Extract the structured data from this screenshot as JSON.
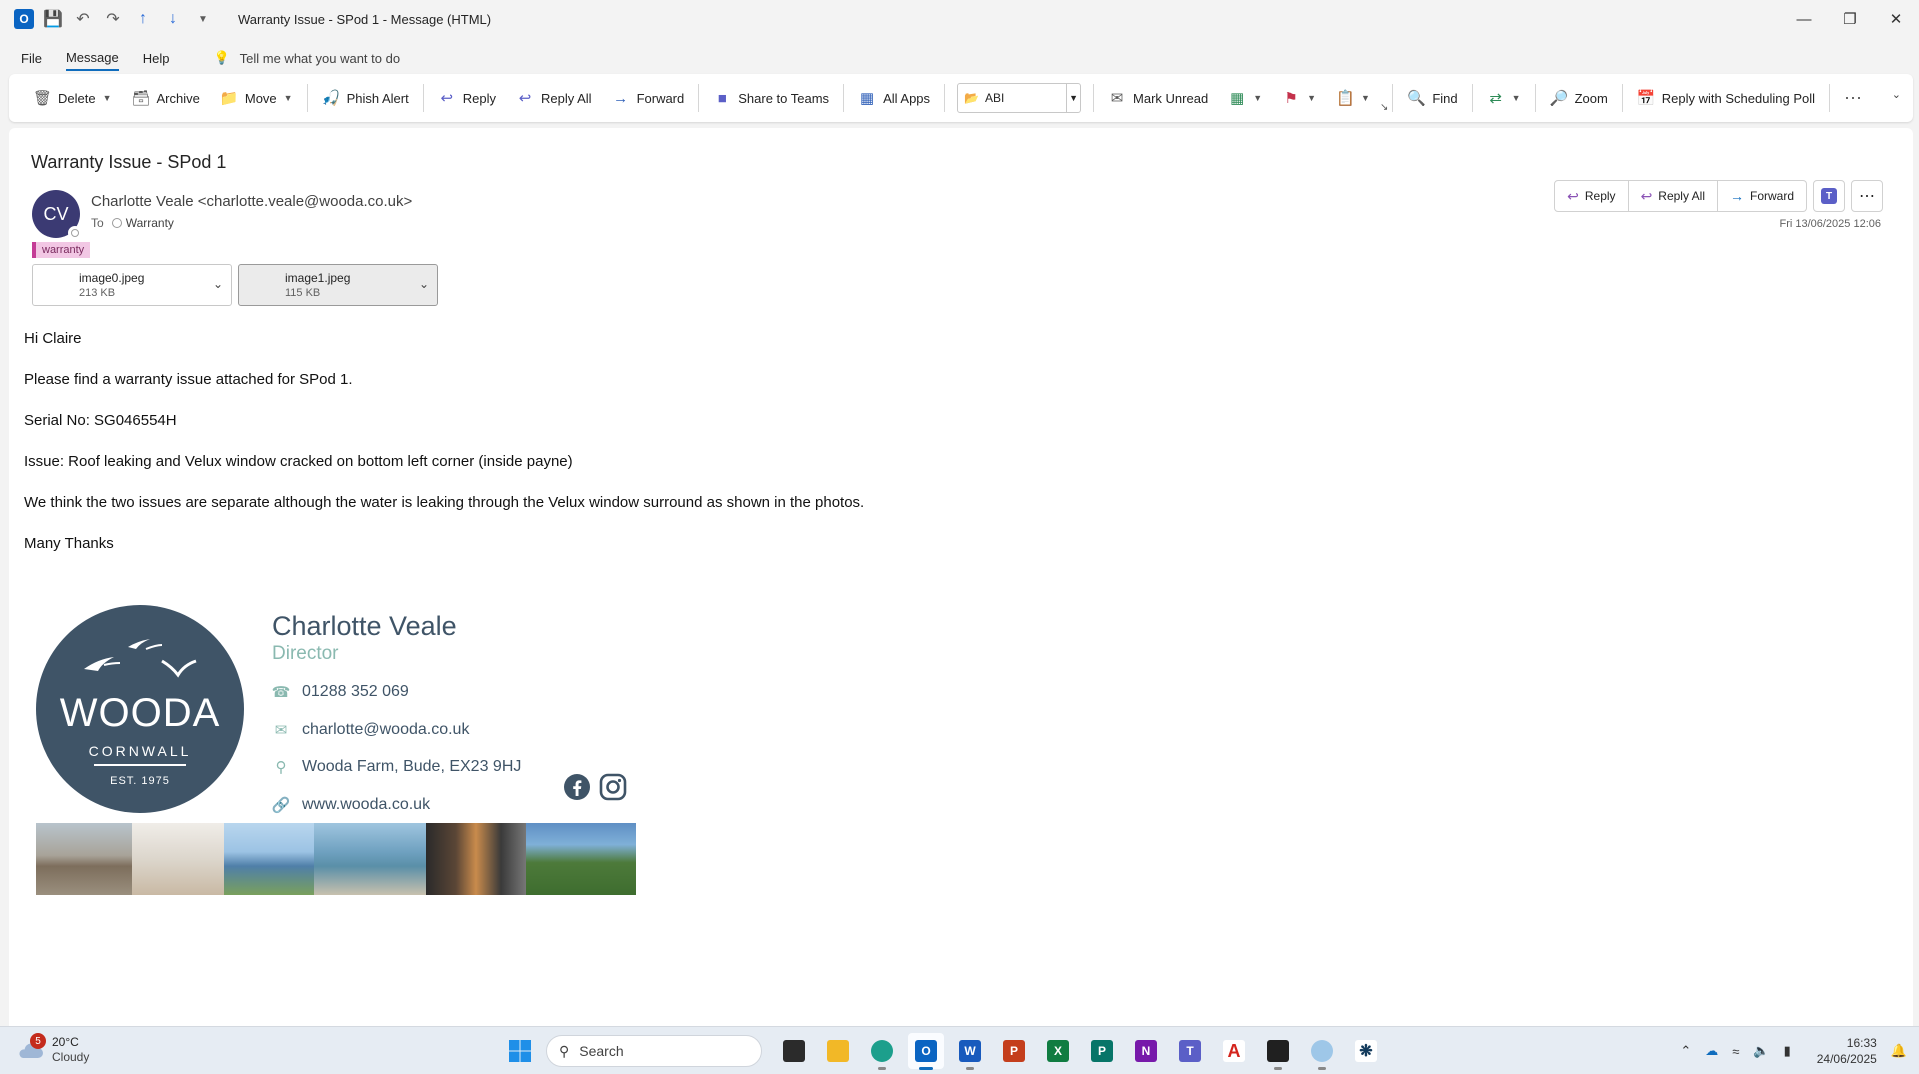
{
  "window": {
    "title": "Warranty Issue - SPod 1  -  Message (HTML)",
    "controls": [
      "minimize",
      "restore",
      "close"
    ]
  },
  "menu": {
    "tabs": [
      "File",
      "Message",
      "Help"
    ],
    "active_tab": "Message",
    "tell_me": "Tell me what you want to do"
  },
  "ribbon": {
    "delete": "Delete",
    "archive": "Archive",
    "move": "Move",
    "phish_alert": "Phish Alert",
    "reply": "Reply",
    "reply_all": "Reply All",
    "forward": "Forward",
    "share_to_teams": "Share to Teams",
    "all_apps": "All Apps",
    "quick_step": "ABI",
    "mark_unread": "Mark Unread",
    "find": "Find",
    "zoom": "Zoom",
    "reply_scheduling_poll": "Reply with Scheduling Poll"
  },
  "message": {
    "subject": "Warranty Issue - SPod 1",
    "avatar_initials": "CV",
    "avatar_color": "#3b3a73",
    "sender": "Charlotte Veale <charlotte.veale@wooda.co.uk>",
    "to_label": "To",
    "recipient": "Warranty",
    "category": "warranty",
    "date": "Fri 13/06/2025 12:06",
    "actions": {
      "reply": "Reply",
      "reply_all": "Reply All",
      "forward": "Forward"
    },
    "attachments": [
      {
        "name": "image0.jpeg",
        "size": "213 KB"
      },
      {
        "name": "image1.jpeg",
        "size": "115 KB"
      }
    ],
    "body": [
      "Hi Claire",
      "Please find a warranty issue attached for SPod 1.",
      "Serial No: SG046554H",
      "Issue: Roof leaking and Velux window cracked on bottom left corner (inside payne)",
      "We think the two issues are separate although the water is leaking through the Velux window surround as shown in the photos.",
      "Many Thanks"
    ]
  },
  "signature": {
    "logo_brand": "WOODA",
    "logo_region": "CORNWALL",
    "logo_est": "EST. 1975",
    "name": "Charlotte Veale",
    "role": "Director",
    "phone": "01288 352 069",
    "email": "charlotte@wooda.co.uk",
    "address": "Wooda Farm, Bude, EX23 9HJ",
    "website": "www.wooda.co.uk",
    "social": [
      "facebook-icon",
      "instagram-icon"
    ],
    "brand_color": "#3f5467",
    "accent_color": "#8ab9b0"
  },
  "taskbar": {
    "weather_temp": "20°C",
    "weather_condition": "Cloudy",
    "weather_badge": "5",
    "search_placeholder": "Search",
    "time": "16:33",
    "date": "24/06/2025"
  }
}
